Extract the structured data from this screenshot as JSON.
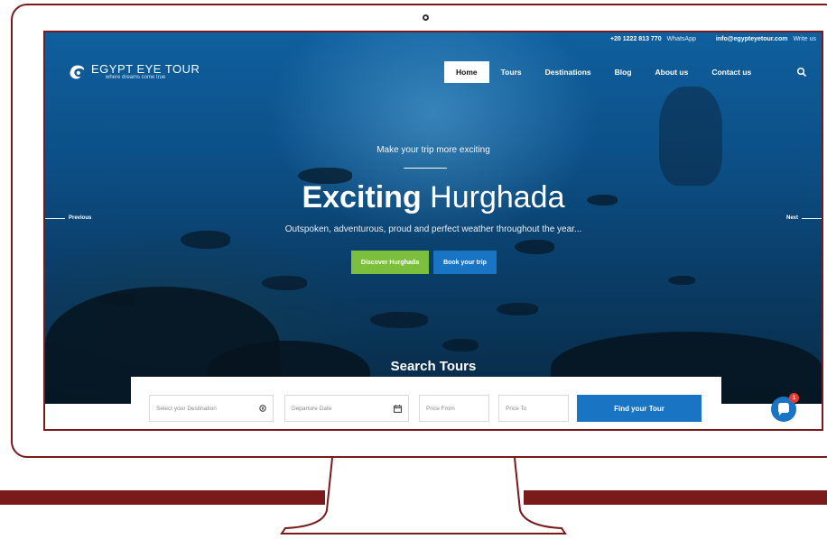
{
  "topbar": {
    "phone": "+20 1222 813 770",
    "whatsapp": "WhatsApp",
    "email": "info@egypteyetour.com",
    "write": "Write us"
  },
  "logo": {
    "title": "EGYPT EYE TOUR",
    "subtitle": "where dreams come true"
  },
  "nav": {
    "items": [
      {
        "label": "Home"
      },
      {
        "label": "Tours"
      },
      {
        "label": "Destinations"
      },
      {
        "label": "Blog"
      },
      {
        "label": "About us"
      },
      {
        "label": "Contact us"
      }
    ]
  },
  "hero": {
    "kicker": "Make your trip more exciting",
    "title_bold": "Exciting",
    "title_light": "Hurghada",
    "subtitle": "Outspoken, adventurous, proud and perfect weather throughout the year...",
    "primary_cta": "Discover Hurghada",
    "secondary_cta": "Book your trip",
    "prev_label": "Previous",
    "next_label": "Next"
  },
  "search": {
    "title": "Search Tours",
    "destination_placeholder": "Select your Destination",
    "date_placeholder": "Departure Date",
    "price_from_placeholder": "Price From",
    "price_to_placeholder": "Price To",
    "submit_label": "Find your Tour"
  },
  "chat": {
    "badge": "1"
  },
  "colors": {
    "brand_maroon": "#7a1a1a",
    "accent_blue": "#1a74c4",
    "accent_green": "#7bbf3d"
  }
}
